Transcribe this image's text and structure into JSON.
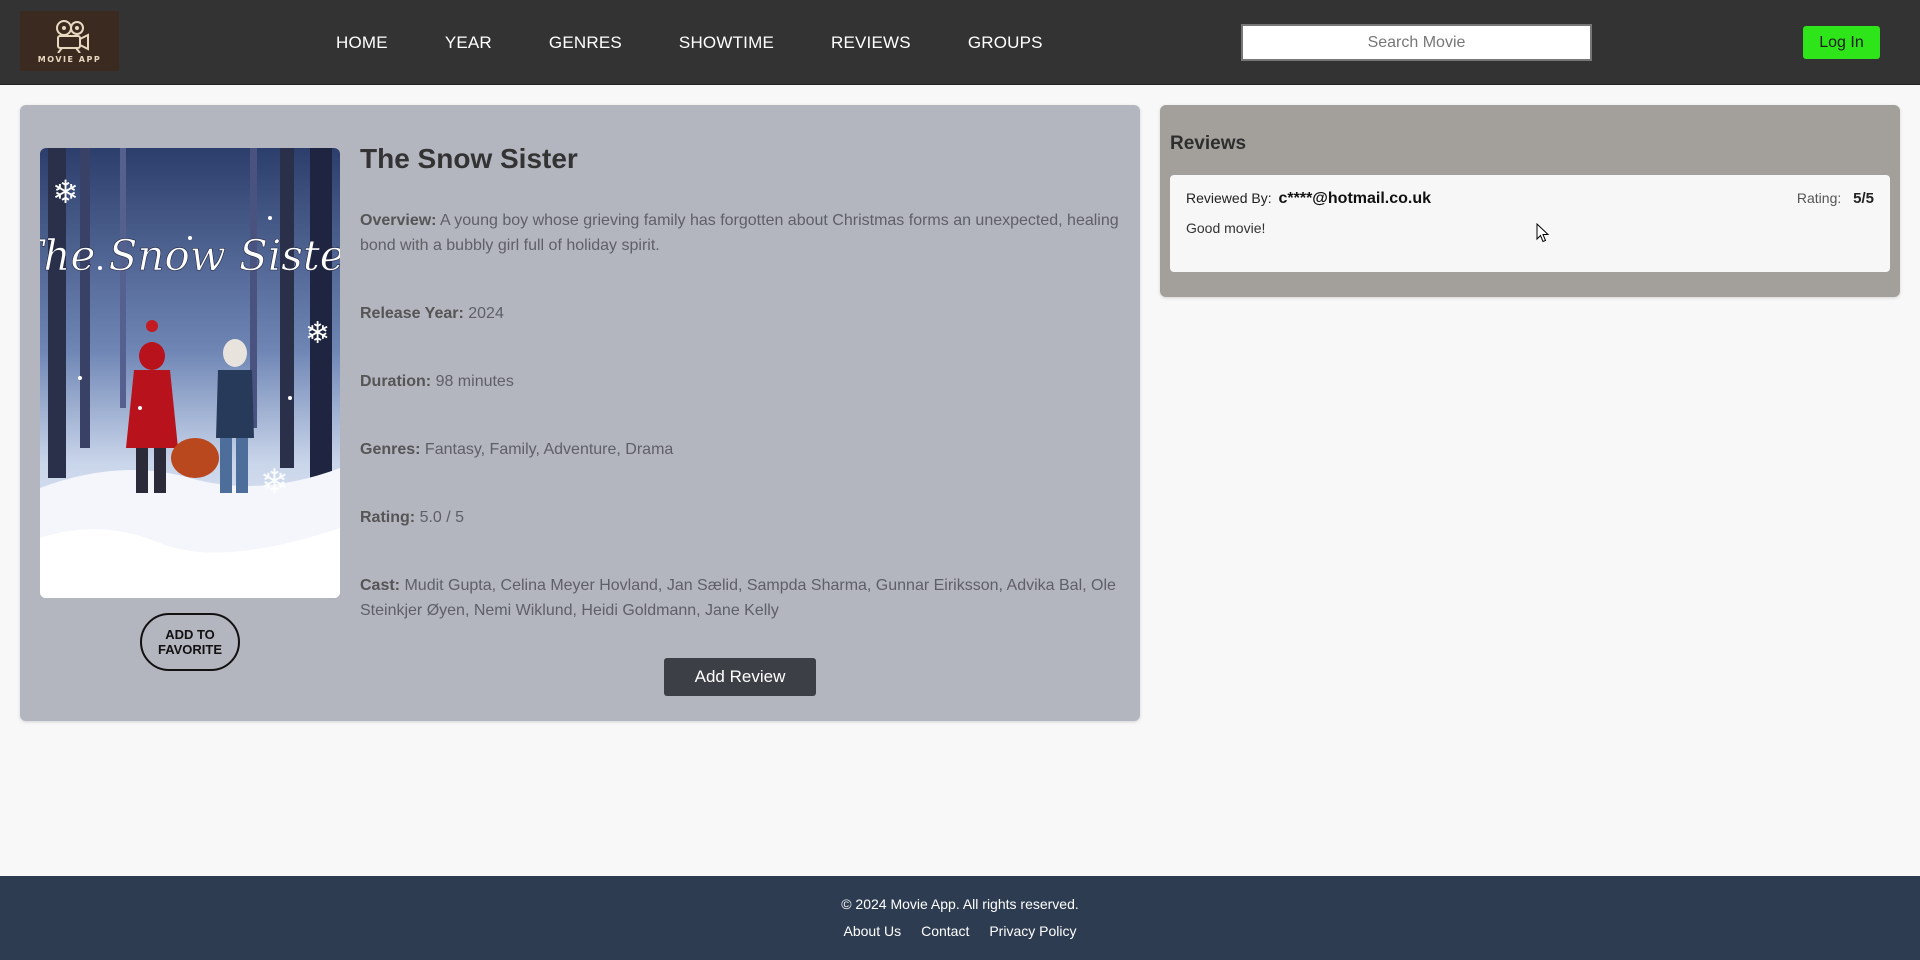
{
  "header": {
    "logo_text": "MOVIE APP",
    "nav": [
      "HOME",
      "YEAR",
      "GENRES",
      "SHOWTIME",
      "REVIEWS",
      "GROUPS"
    ],
    "search_placeholder": "Search Movie",
    "login_label": "Log In",
    "login_color": "#2ee51a"
  },
  "movie": {
    "poster_title": "The Snow Sister",
    "title": "The Snow Sister",
    "favorite_label_line1": "ADD TO",
    "favorite_label_line2": "FAVORITE",
    "overview_label": "Overview:",
    "overview": "A young boy whose grieving family has forgotten about Christmas forms an unexpected, healing bond with a bubbly girl full of holiday spirit.",
    "year_label": "Release Year:",
    "year": "2024",
    "duration_label": "Duration:",
    "duration": "98 minutes",
    "genres_label": "Genres:",
    "genres": "Fantasy, Family, Adventure, Drama",
    "rating_label": "Rating:",
    "rating": "5.0 / 5",
    "cast_label": "Cast:",
    "cast": "Mudit Gupta, Celina Meyer Hovland, Jan Sælid, Sampda Sharma, Gunnar Eiriksson, Advika Bal, Ole Steinkjer Øyen, Nemi Wiklund, Heidi Goldmann, Jane Kelly",
    "add_review_label": "Add Review"
  },
  "reviews": {
    "title": "Reviews",
    "items": [
      {
        "by_label": "Reviewed By:",
        "email": "c****@hotmail.co.uk",
        "rating_label": "Rating:",
        "rating": "5/5",
        "text": "Good movie!"
      }
    ]
  },
  "footer": {
    "copyright": "© 2024 Movie App. All rights reserved.",
    "links": [
      "About Us",
      "Contact",
      "Privacy Policy"
    ]
  },
  "colors": {
    "header_bg": "#333333",
    "movie_panel_bg": "#b3b5bf",
    "reviews_panel_bg": "#a3a09c",
    "footer_bg": "#2d3c50"
  }
}
